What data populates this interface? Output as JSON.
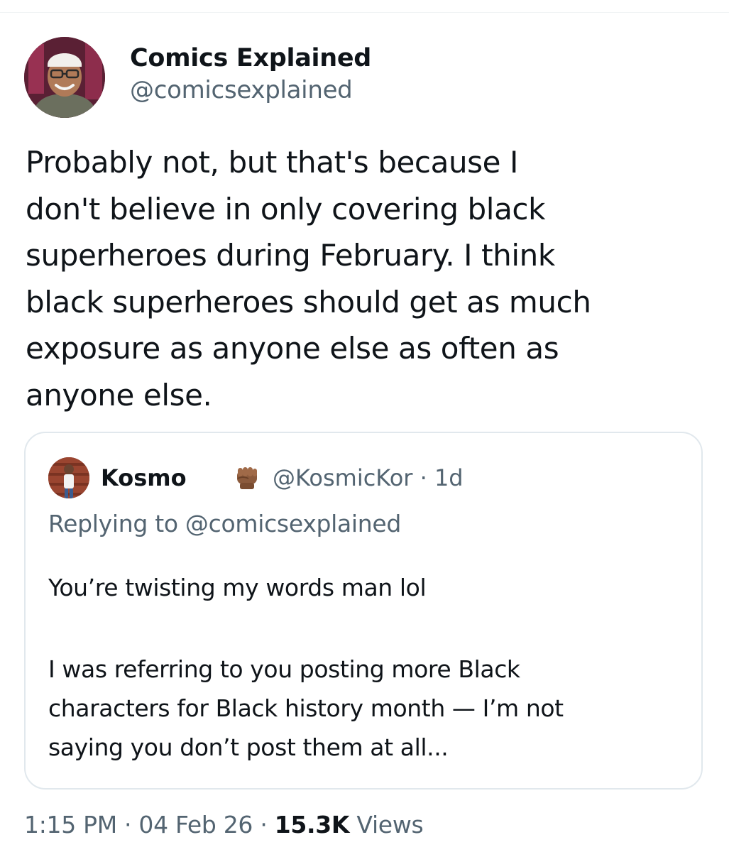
{
  "author": {
    "display_name": "Comics Explained",
    "handle": "@comicsexplained",
    "avatar_icon": "profile-photo-icon"
  },
  "tweet": {
    "text_lines": [
      "Probably not, but that's because I",
      "don't believe in only covering black",
      "superheroes during February. I think",
      "black superheroes should get as much",
      "exposure as anyone else as often as",
      "anyone else."
    ]
  },
  "quote": {
    "display_name": "Kosmo",
    "emoji_icon": "raised-fist-icon",
    "handle_time": "@KosmicKor · 1d",
    "replying_to": "Replying to @comicsexplained",
    "paragraph1": "You’re twisting my words man lol",
    "paragraph2_lines": [
      "I was referring to you posting more Black",
      "characters for Black history month — I’m not",
      "saying you don’t post them at all..."
    ]
  },
  "meta": {
    "time_date": "1:15 PM · 04 Feb 26 · ",
    "views_count": "15.3K",
    "views_label": " Views"
  },
  "colors": {
    "text_primary": "#0f1419",
    "text_secondary": "#536471",
    "border": "#e1e8ed",
    "background": "#ffffff"
  }
}
